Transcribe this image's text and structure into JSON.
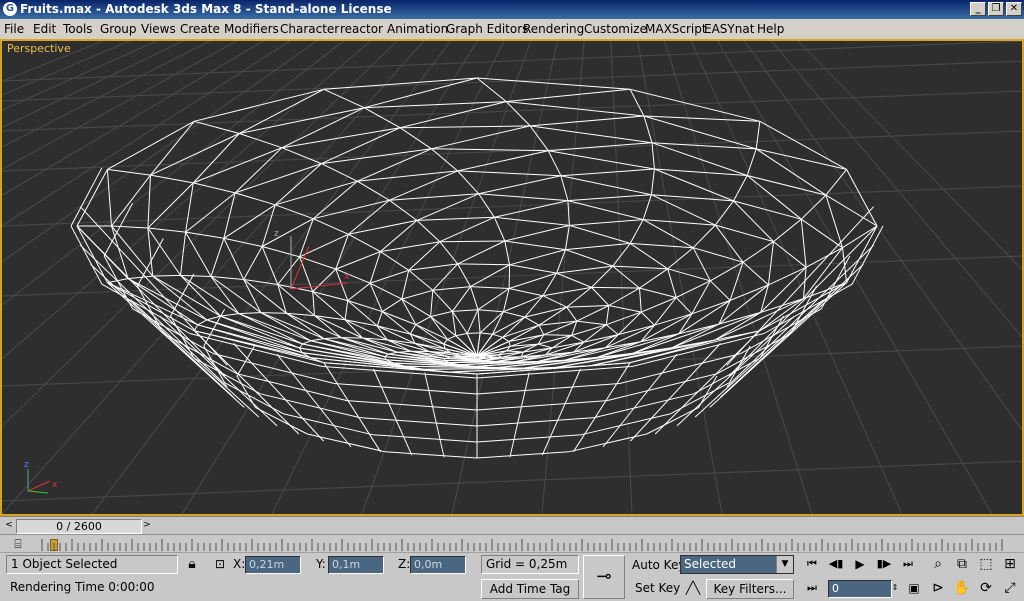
{
  "window": {
    "title": "Fruits.max - Autodesk 3ds Max 8  - Stand-alone License",
    "minimize_glyph": "_",
    "restore_glyph": "❐",
    "close_glyph": "✕",
    "app_icon": "3ds-max-icon"
  },
  "menu": {
    "items": [
      "File",
      "Edit",
      "Tools",
      "Group",
      "Views",
      "Create",
      "Modifiers",
      "Character",
      "reactor",
      "Animation",
      "Graph Editors",
      "Rendering",
      "Customize",
      "MAXScript",
      "EASYnat",
      "Help"
    ]
  },
  "viewport": {
    "label": "Perspective",
    "background": "#2e2e2e",
    "border_color": "#d9a520",
    "wire_color": "#ffffff",
    "gizmo_axes": [
      "x",
      "y",
      "z"
    ]
  },
  "timeline": {
    "frame_display": "0 / 2600",
    "prev_label": "<",
    "next_label": ">",
    "current_frame": 0,
    "total_frames": 2600
  },
  "status": {
    "selection": "1 Object Selected",
    "render_time": "Rendering Time  0:00:00",
    "x_label": "X:",
    "x_value": "0,21m",
    "y_label": "Y:",
    "y_value": "0,1m",
    "z_label": "Z:",
    "z_value": "0,0m",
    "grid": "Grid = 0,25m",
    "add_time_tag": "Add Time Tag"
  },
  "animation": {
    "auto_key": "Auto Key",
    "set_key": "Set Key",
    "selected_dropdown": "Selected",
    "key_filters": "Key Filters...",
    "frame_input": "0"
  }
}
